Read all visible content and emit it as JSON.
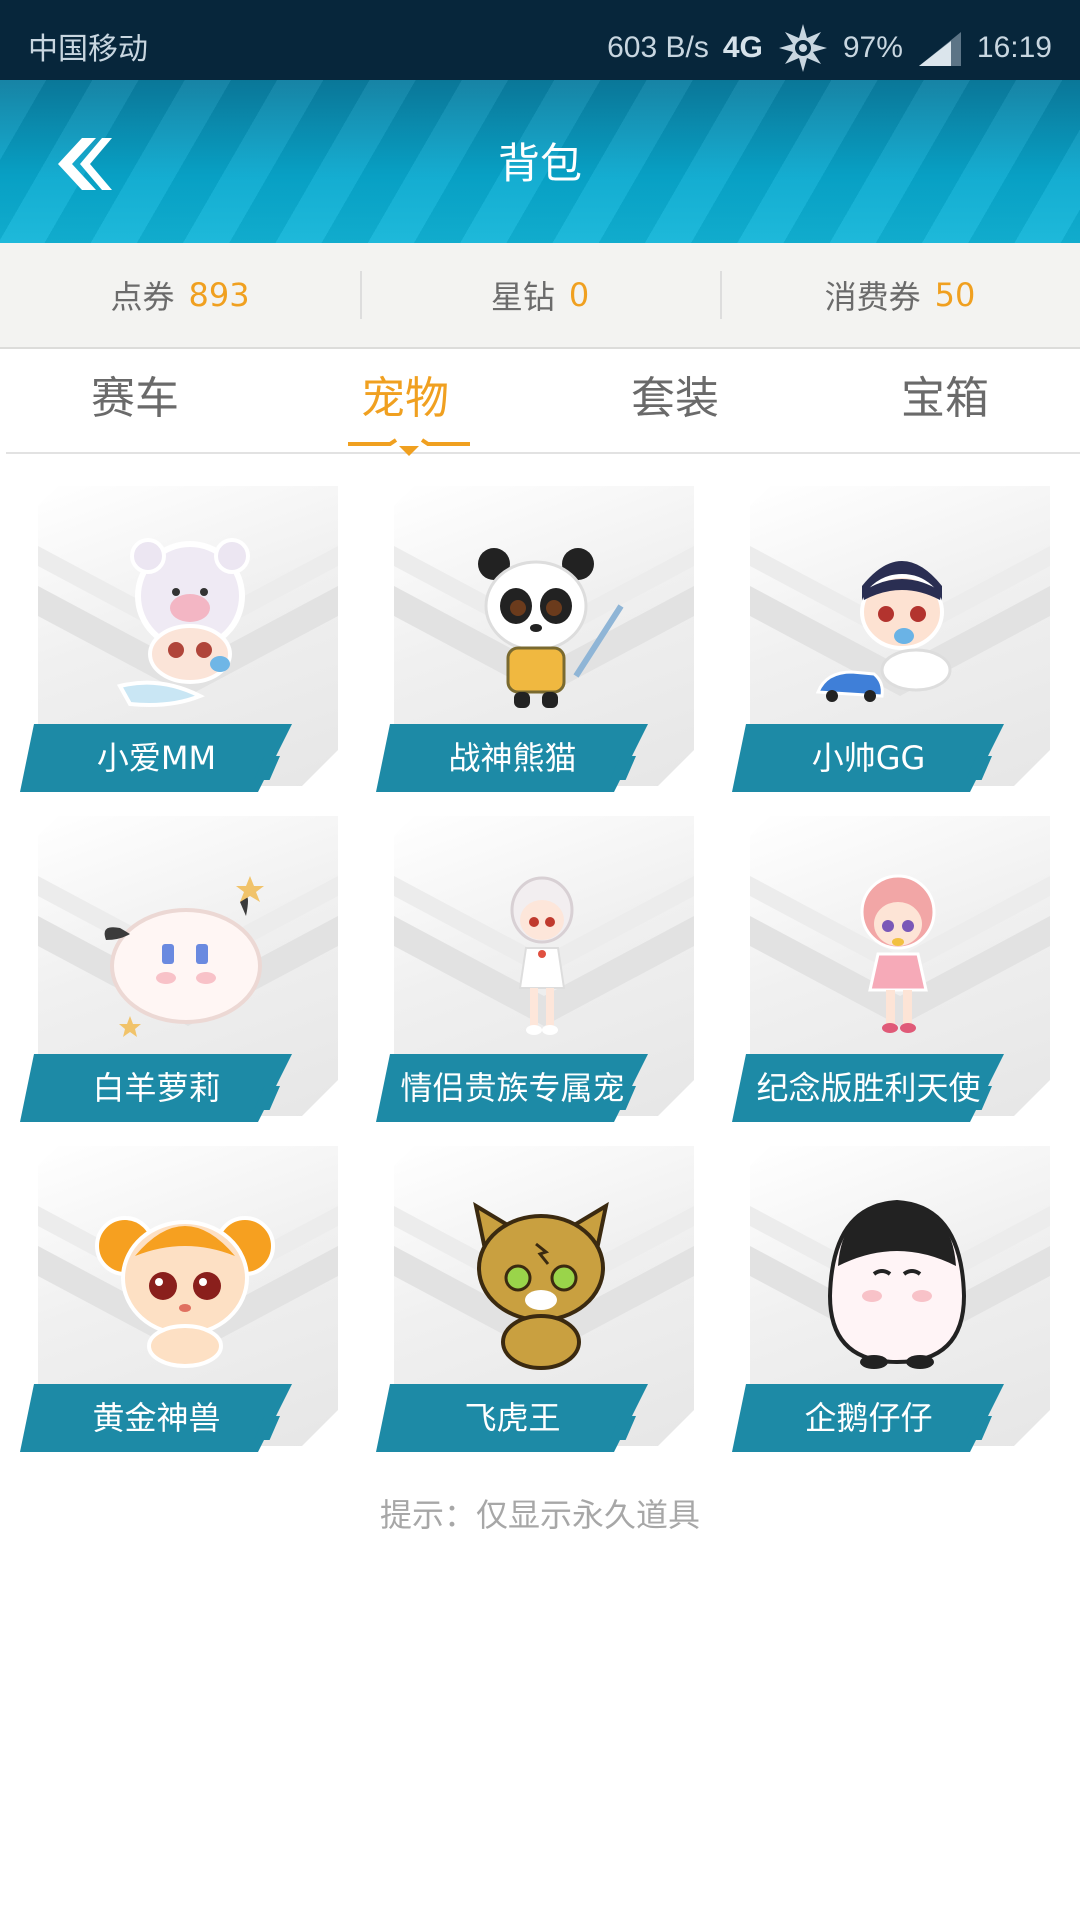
{
  "status_bar": {
    "carrier": "中国移动",
    "speed": "603 B/s",
    "network": "4G",
    "battery": "97%",
    "time": "16:19"
  },
  "header": {
    "title": "背包",
    "back_icon": "double-chevron-left-icon"
  },
  "currencies": [
    {
      "label": "点券",
      "value": "893"
    },
    {
      "label": "星钻",
      "value": "0"
    },
    {
      "label": "消费券",
      "value": "50"
    }
  ],
  "tabs": [
    {
      "label": "赛车",
      "active": false
    },
    {
      "label": "宠物",
      "active": true
    },
    {
      "label": "套装",
      "active": false
    },
    {
      "label": "宝箱",
      "active": false
    }
  ],
  "pets": [
    {
      "name": "小爱MM",
      "icon": "bear-hat-girl-pet-icon"
    },
    {
      "name": "战神熊猫",
      "icon": "panda-sword-pet-icon"
    },
    {
      "name": "小帅GG",
      "icon": "baby-boy-car-pet-icon"
    },
    {
      "name": "白羊萝莉",
      "icon": "fluffy-sheep-pet-icon"
    },
    {
      "name": "情侣贵族专属宠",
      "icon": "white-hair-girl-pet-icon"
    },
    {
      "name": "纪念版胜利天使",
      "icon": "pink-hair-girl-pet-icon"
    },
    {
      "name": "黄金神兽",
      "icon": "orange-hamster-pet-icon"
    },
    {
      "name": "飞虎王",
      "icon": "tiger-cub-pet-icon"
    },
    {
      "name": "企鹅仔仔",
      "icon": "penguin-pet-icon"
    }
  ],
  "tip": "提示：仅显示永久道具",
  "colors": {
    "accent": "#f0a020",
    "label_bar": "#1d8aa6",
    "header": "#08a9cf",
    "status_bar": "#07263b"
  }
}
